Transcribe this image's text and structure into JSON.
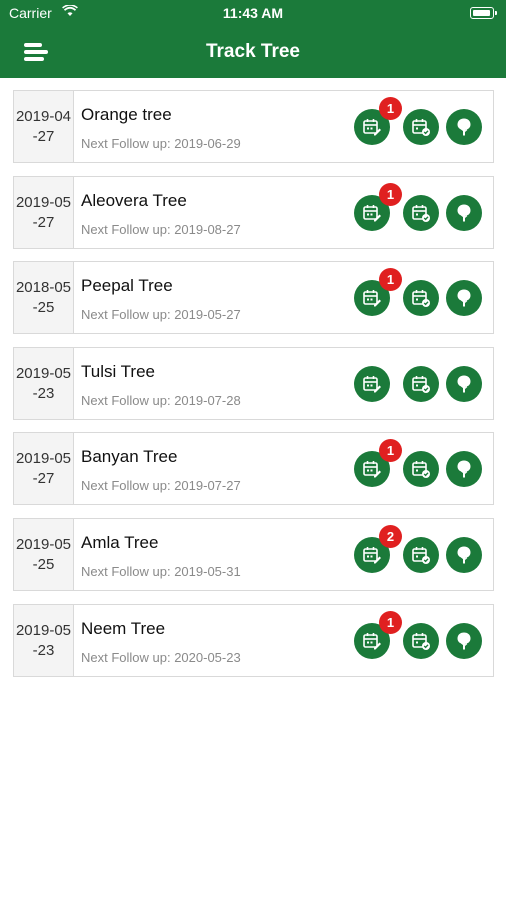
{
  "status_bar": {
    "carrier": "Carrier",
    "time": "11:43 AM"
  },
  "nav": {
    "title": "Track Tree"
  },
  "trees": [
    {
      "date": "2019-04\n-27",
      "name": "Orange tree",
      "follow_up": "Next Follow up: 2019-06-29",
      "badge": "1"
    },
    {
      "date": "2019-05\n-27",
      "name": "Aleovera Tree",
      "follow_up": "Next Follow up: 2019-08-27",
      "badge": "1"
    },
    {
      "date": "2018-05\n-25",
      "name": "Peepal Tree",
      "follow_up": "Next Follow up: 2019-05-27",
      "badge": "1"
    },
    {
      "date": "2019-05\n-23",
      "name": "Tulsi Tree",
      "follow_up": "Next Follow up: 2019-07-28",
      "badge": ""
    },
    {
      "date": "2019-05\n-27",
      "name": "Banyan Tree",
      "follow_up": "Next Follow up: 2019-07-27",
      "badge": "1"
    },
    {
      "date": "2019-05\n-25",
      "name": "Amla Tree",
      "follow_up": "Next Follow up: 2019-05-31",
      "badge": "2"
    },
    {
      "date": "2019-05\n-23",
      "name": "Neem Tree",
      "follow_up": "Next Follow up: 2020-05-23",
      "badge": "1"
    }
  ],
  "icons": {
    "menu": "hamburger-menu-icon",
    "action_1": "calendar-edit-icon",
    "action_2": "calendar-check-icon",
    "action_3": "tree-icon"
  },
  "colors": {
    "primary": "#1b7a3a",
    "badge": "#e02020"
  }
}
